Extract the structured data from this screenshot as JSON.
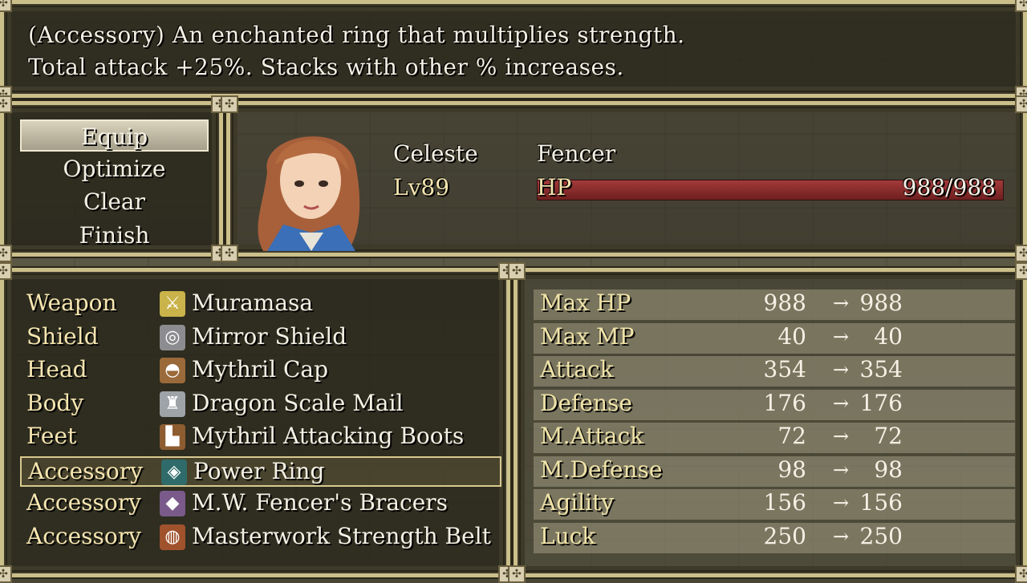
{
  "help": {
    "line1": "(Accessory) An enchanted ring that multiplies strength.",
    "line2": "Total attack +25%. Stacks with other % increases."
  },
  "commands": [
    {
      "label": "Equip",
      "selected": true
    },
    {
      "label": "Optimize",
      "selected": false
    },
    {
      "label": "Clear",
      "selected": false
    },
    {
      "label": "Finish",
      "selected": false
    }
  ],
  "actor": {
    "name": "Celeste",
    "class": "Fencer",
    "level": "Lv89",
    "hp_label": "HP",
    "hp_value": "988/988",
    "hp_fraction": 1.0,
    "portrait_icon": "portrait-celeste"
  },
  "slots": [
    {
      "label": "Weapon",
      "item": "Muramasa",
      "icon": "sword-icon",
      "icon_char": "⚔",
      "icon_color": "#c9b34a",
      "selected": false
    },
    {
      "label": "Shield",
      "item": "Mirror Shield",
      "icon": "shield-icon",
      "icon_char": "◎",
      "icon_color": "#8c8c90",
      "selected": false
    },
    {
      "label": "Head",
      "item": "Mythril Cap",
      "icon": "helmet-icon",
      "icon_char": "◓",
      "icon_color": "#9b6a3a",
      "selected": false
    },
    {
      "label": "Body",
      "item": "Dragon Scale Mail",
      "icon": "armor-icon",
      "icon_char": "♜",
      "icon_color": "#9ea3a8",
      "selected": false
    },
    {
      "label": "Feet",
      "item": "Mythril Attacking Boots",
      "icon": "boots-icon",
      "icon_char": "▙",
      "icon_color": "#8d5c31",
      "selected": false
    },
    {
      "label": "Accessory",
      "item": "Power Ring",
      "icon": "ring-icon",
      "icon_char": "◈",
      "icon_color": "#2f6b6a",
      "selected": true
    },
    {
      "label": "Accessory",
      "item": "M.W. Fencer's Bracers",
      "icon": "bracers-icon",
      "icon_char": "◆",
      "icon_color": "#7a5a8a",
      "selected": false
    },
    {
      "label": "Accessory",
      "item": "Masterwork Strength Belt",
      "icon": "belt-icon",
      "icon_char": "◍",
      "icon_color": "#a0522d",
      "selected": false
    }
  ],
  "params": [
    {
      "name": "Max HP",
      "current": "988",
      "new": "988"
    },
    {
      "name": "Max MP",
      "current": "40",
      "new": "40"
    },
    {
      "name": "Attack",
      "current": "354",
      "new": "354"
    },
    {
      "name": "Defense",
      "current": "176",
      "new": "176"
    },
    {
      "name": "M.Attack",
      "current": "72",
      "new": "72"
    },
    {
      "name": "M.Defense",
      "current": "98",
      "new": "98"
    },
    {
      "name": "Agility",
      "current": "156",
      "new": "156"
    },
    {
      "name": "Luck",
      "current": "250",
      "new": "250"
    }
  ],
  "arrow": "→",
  "corner_glyph": "✣",
  "colors": {
    "hp_bar": "#a33a3a",
    "frame": "#cbbf8a",
    "system_text": "#f5e5b0"
  }
}
